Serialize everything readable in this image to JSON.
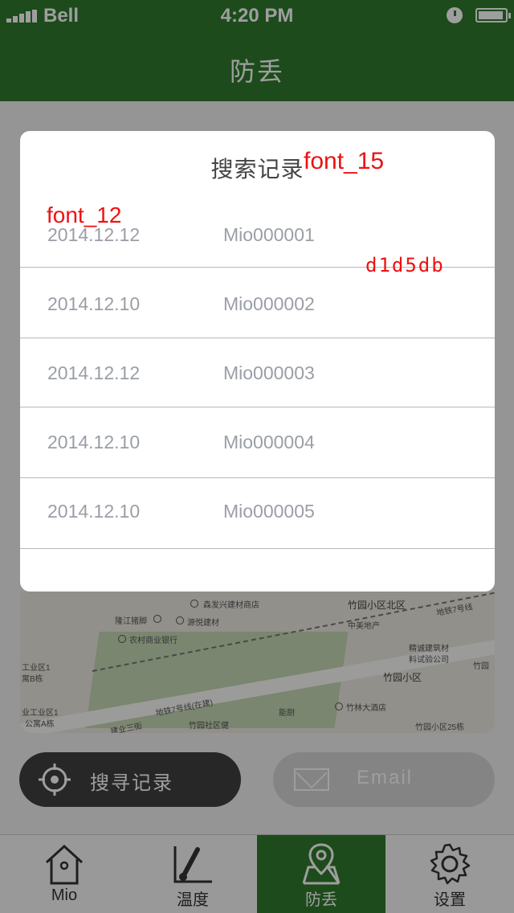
{
  "status": {
    "carrier": "Bell",
    "time": "4:20 PM"
  },
  "nav": {
    "title": "防丢"
  },
  "map_labels": {
    "l1": "森发兴建材商店",
    "l2": "竹园小区北区",
    "l3": "隆江猪脚",
    "l4": "源悦建材",
    "l5": "中美地产",
    "l6": "地铁7号线",
    "l7": "农村商业银行",
    "l8": "精诚建筑材",
    "l9": "料试验公司",
    "l10": "竹园",
    "l11": "工业区1",
    "l12": "寓B栋",
    "l13": "竹园小区",
    "l14": "业工业区1",
    "l15": "公寓A栋",
    "l16": "地铁7号线(在建)",
    "l17": "建业三街",
    "l18": "能厨",
    "l19": "竹林大酒店",
    "l20": "竹园社区健",
    "l21": "竹园小区25栋"
  },
  "buttons": {
    "search": "搜寻记录",
    "email": "Email"
  },
  "tabs": [
    {
      "label": "Mio"
    },
    {
      "label": "温度"
    },
    {
      "label": "防丢"
    },
    {
      "label": "设置"
    }
  ],
  "dialog": {
    "title": "搜索记录",
    "rows": [
      {
        "date": "2014.12.12",
        "id": "Mio000001"
      },
      {
        "date": "2014.12.10",
        "id": "Mio000002"
      },
      {
        "date": "2014.12.12",
        "id": "Mio000003"
      },
      {
        "date": "2014.12.10",
        "id": "Mio000004"
      },
      {
        "date": "2014.12.10",
        "id": "Mio000005"
      }
    ]
  },
  "annotations": {
    "title_font": "font_15",
    "row_font": "font_12",
    "divider_color": "d1d5db"
  },
  "colors": {
    "brand_green": "#2f7a2c",
    "divider": "#b5b8bd",
    "annotation_red": "#ee1111"
  }
}
